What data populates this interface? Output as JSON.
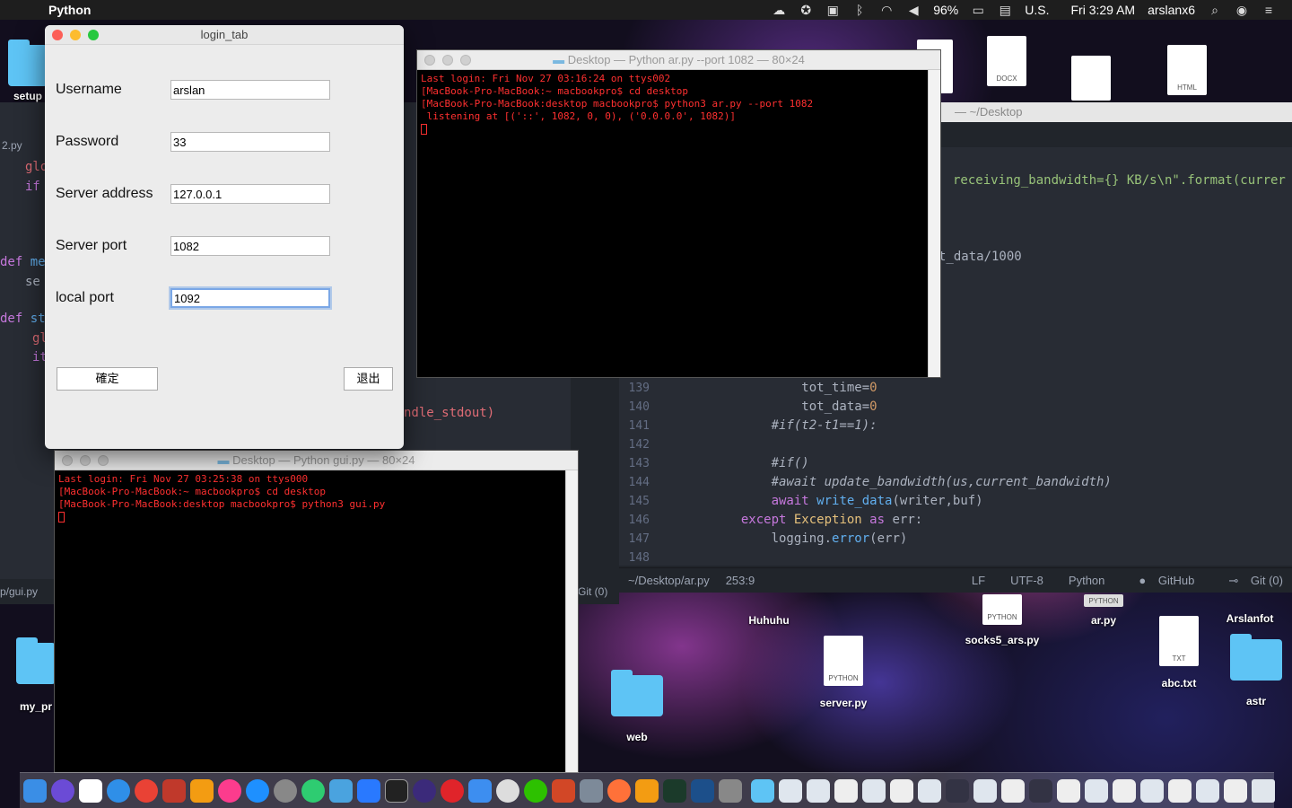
{
  "menubar": {
    "app_name": "Python",
    "battery": "96%",
    "input_source": "U.S.",
    "clock": "Fri 3:29 AM",
    "user": "arslanx6"
  },
  "desktop_icons": [
    {
      "label": "setup",
      "kind": "folder"
    },
    {
      "label": "my_pr",
      "kind": "folder"
    },
    {
      "label": "Huhuhu",
      "kind": "folder"
    },
    {
      "label": "web",
      "kind": "folder"
    },
    {
      "label": "server.py",
      "kind": "doc",
      "type": "PYTHON"
    },
    {
      "label": "socks5_ars.py",
      "kind": "doc",
      "type": "PYTHON"
    },
    {
      "label": "ar.py",
      "kind": "doc",
      "type": "PYTHON"
    },
    {
      "label": "abc.txt",
      "kind": "doc",
      "type": "TXT"
    },
    {
      "label": "Arslanfot",
      "kind": "folder"
    },
    {
      "label": "astr",
      "kind": "folder"
    },
    {
      "label": "",
      "kind": "doc",
      "type": "DOCX"
    },
    {
      "label": "",
      "kind": "doc",
      "type": "HTML"
    }
  ],
  "login": {
    "title": "login_tab",
    "fields": [
      {
        "label": "Username",
        "value": "arslan"
      },
      {
        "label": "Password",
        "value": "33"
      },
      {
        "label": "Server address",
        "value": "127.0.0.1"
      },
      {
        "label": "Server port",
        "value": "1082"
      },
      {
        "label": "local port",
        "value": "1092"
      }
    ],
    "ok_label": "確定",
    "exit_label": "退出"
  },
  "terminal_ar": {
    "title": "Desktop — Python ar.py --port 1082 — 80×24",
    "lines": [
      "Last login: Fri Nov 27 03:16:24 on ttys002",
      "[MacBook-Pro-MacBook:~ macbookpro$ cd desktop",
      "[MacBook-Pro-MacBook:desktop macbookpro$ python3 ar.py --port 1082",
      " listening at [('::', 1082, 0, 0), ('0.0.0.0', 1082)]"
    ]
  },
  "terminal_gui": {
    "title": "Desktop — Python gui.py — 80×24",
    "lines": [
      "Last login: Fri Nov 27 03:25:38 on ttys000",
      "[MacBook-Pro-MacBook:~ macbookpro$ cd desktop",
      "[MacBook-Pro-MacBook:desktop macbookpro$ python3 gui.py"
    ]
  },
  "editor": {
    "title_fragment": "— ~/Desktop",
    "left_tab": "2.py",
    "left_status": "p/gui.py",
    "mid_status": "Git (0)",
    "fragment_bandwidth": "receiving_bandwidth={} KB/s\\n\".format(currer",
    "fragment_data": "t_data/1000",
    "fragment_stdout": "ndle_stdout)",
    "line_numbers": [
      "139",
      "140",
      "141",
      "142",
      "143",
      "144",
      "145",
      "146",
      "147",
      "148"
    ],
    "status": {
      "path": "~/Desktop/ar.py",
      "cursor": "253:9",
      "eol": "LF",
      "encoding": "UTF-8",
      "grammar": "Python",
      "github": "GitHub",
      "git": "Git (0)"
    }
  }
}
